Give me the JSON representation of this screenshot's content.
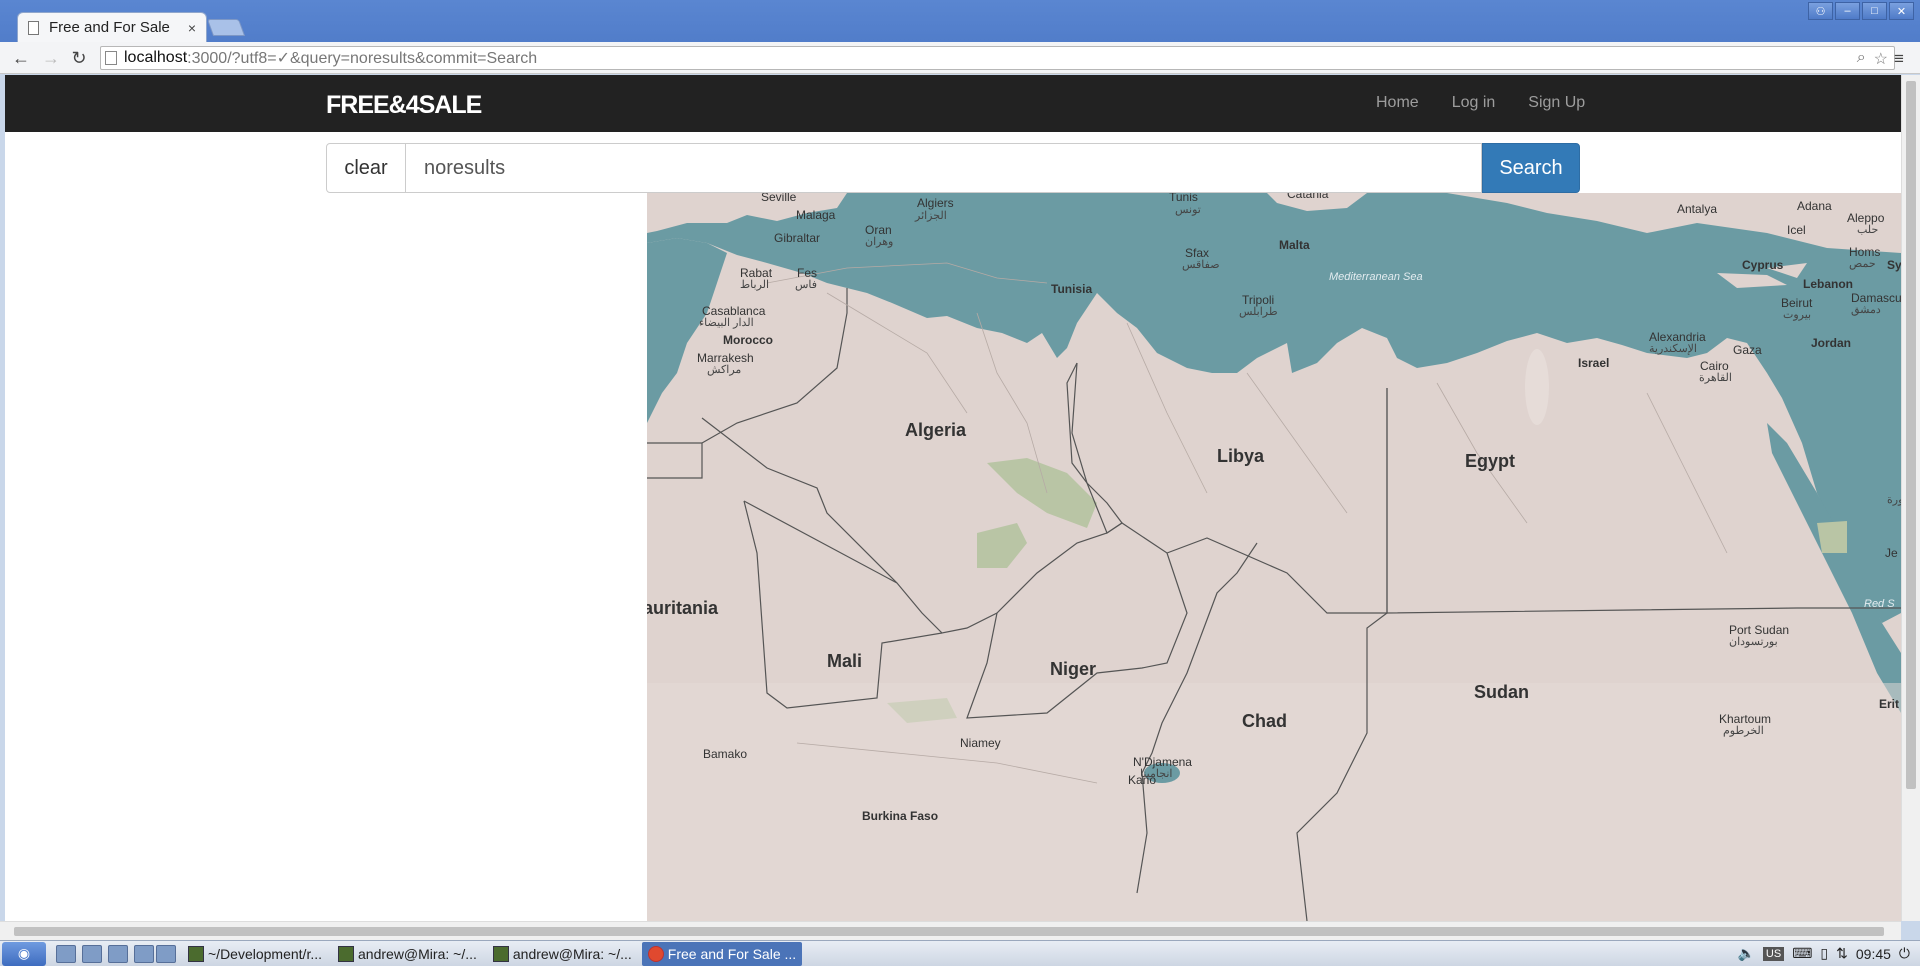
{
  "browser": {
    "tab_title": "Free and For Sale",
    "tab_close": "×",
    "url_host": "localhost",
    "url_rest": ":3000/?utf8=✓&query=noresults&commit=Search",
    "window_controls": [
      "⚇",
      "–",
      "□",
      "✕"
    ]
  },
  "navbar": {
    "brand": "FREE&4SALE",
    "links": [
      "Home",
      "Log in",
      "Sign Up"
    ]
  },
  "search": {
    "clear_label": "clear",
    "query": "noresults",
    "submit_label": "Search"
  },
  "map": {
    "countries": [
      "Algeria",
      "Libya",
      "Egypt",
      "Mali",
      "Niger",
      "Chad",
      "Sudan",
      "Morocco",
      "Tunisia",
      "Jordan",
      "Israel",
      "Lebanon",
      "Cyprus",
      "Malta",
      "Burkina Faso"
    ],
    "partial_labels": [
      "auritania",
      "Syri",
      "Erit",
      "Red S",
      "Je",
      "ورة"
    ],
    "cities": [
      "Seville",
      "Malaga",
      "Gibraltar",
      "Algiers",
      "الجزائر",
      "Oran",
      "وهران",
      "Rabat",
      "الرباط",
      "Fes",
      "فاس",
      "Casablanca",
      "الدار البيضاء",
      "Marrakesh",
      "مراكش",
      "Tunis",
      "تونس",
      "Sfax",
      "صفاقس",
      "Tripoli",
      "طرابلس",
      "Catania",
      "Antalya",
      "Adana",
      "Aleppo",
      "حلب",
      "Icel",
      "Homs",
      "حمص",
      "Beirut",
      "بيروت",
      "Damascus",
      "دمشق",
      "Gaza",
      "Alexandria",
      "الإسكندرية",
      "Cairo",
      "القاهرة",
      "Port Sudan",
      "بورتسودان",
      "Khartoum",
      "الخرطوم",
      "Niamey",
      "N'Djamena",
      "انجامينا",
      "Bamako",
      "Kano"
    ],
    "sea": "Mediterranean Sea",
    "colors": {
      "land": "#dfd3cf",
      "water": "#6b9ba3",
      "border": "#555555",
      "vegetation": "#b9c5a5"
    }
  },
  "taskbar": {
    "tasks": [
      "~/Development/r...",
      "andrew@Mira: ~/...",
      "andrew@Mira: ~/...",
      "Free and For Sale ..."
    ],
    "keyboard": "US",
    "clock": "09:45"
  }
}
